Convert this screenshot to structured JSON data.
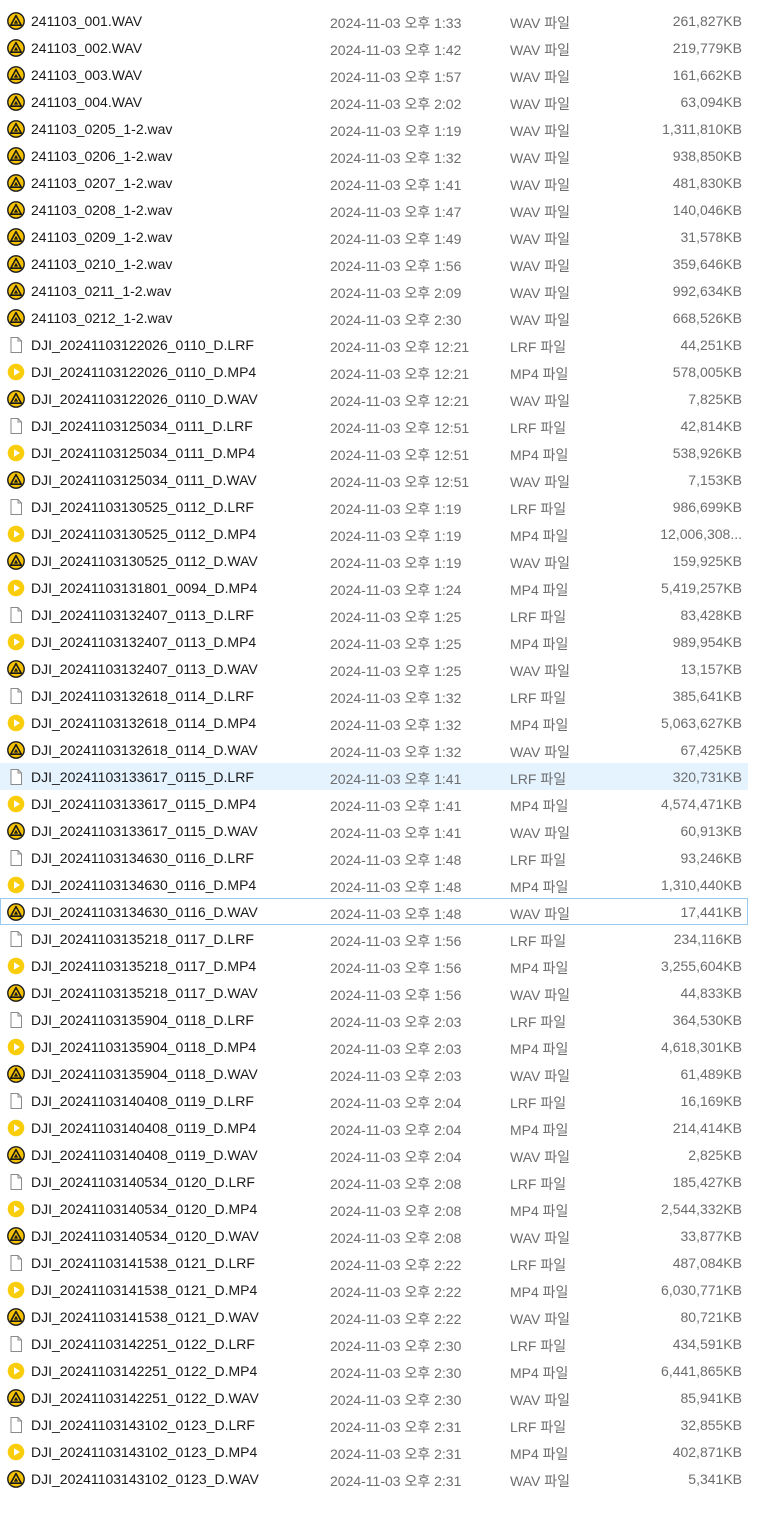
{
  "files": [
    {
      "name": "241103_001.WAV",
      "date": "2024-11-03 오후 1:33",
      "type": "WAV 파일",
      "size": "261,827KB",
      "icon": "audio-file-icon"
    },
    {
      "name": "241103_002.WAV",
      "date": "2024-11-03 오후 1:42",
      "type": "WAV 파일",
      "size": "219,779KB",
      "icon": "audio-file-icon"
    },
    {
      "name": "241103_003.WAV",
      "date": "2024-11-03 오후 1:57",
      "type": "WAV 파일",
      "size": "161,662KB",
      "icon": "audio-file-icon"
    },
    {
      "name": "241103_004.WAV",
      "date": "2024-11-03 오후 2:02",
      "type": "WAV 파일",
      "size": "63,094KB",
      "icon": "audio-file-icon"
    },
    {
      "name": "241103_0205_1-2.wav",
      "date": "2024-11-03 오후 1:19",
      "type": "WAV 파일",
      "size": "1,311,810KB",
      "icon": "audio-file-icon"
    },
    {
      "name": "241103_0206_1-2.wav",
      "date": "2024-11-03 오후 1:32",
      "type": "WAV 파일",
      "size": "938,850KB",
      "icon": "audio-file-icon"
    },
    {
      "name": "241103_0207_1-2.wav",
      "date": "2024-11-03 오후 1:41",
      "type": "WAV 파일",
      "size": "481,830KB",
      "icon": "audio-file-icon"
    },
    {
      "name": "241103_0208_1-2.wav",
      "date": "2024-11-03 오후 1:47",
      "type": "WAV 파일",
      "size": "140,046KB",
      "icon": "audio-file-icon"
    },
    {
      "name": "241103_0209_1-2.wav",
      "date": "2024-11-03 오후 1:49",
      "type": "WAV 파일",
      "size": "31,578KB",
      "icon": "audio-file-icon"
    },
    {
      "name": "241103_0210_1-2.wav",
      "date": "2024-11-03 오후 1:56",
      "type": "WAV 파일",
      "size": "359,646KB",
      "icon": "audio-file-icon"
    },
    {
      "name": "241103_0211_1-2.wav",
      "date": "2024-11-03 오후 2:09",
      "type": "WAV 파일",
      "size": "992,634KB",
      "icon": "audio-file-icon"
    },
    {
      "name": "241103_0212_1-2.wav",
      "date": "2024-11-03 오후 2:30",
      "type": "WAV 파일",
      "size": "668,526KB",
      "icon": "audio-file-icon"
    },
    {
      "name": "DJI_20241103122026_0110_D.LRF",
      "date": "2024-11-03 오후 12:21",
      "type": "LRF 파일",
      "size": "44,251KB",
      "icon": "blank-file-icon"
    },
    {
      "name": "DJI_20241103122026_0110_D.MP4",
      "date": "2024-11-03 오후 12:21",
      "type": "MP4 파일",
      "size": "578,005KB",
      "icon": "video-file-icon"
    },
    {
      "name": "DJI_20241103122026_0110_D.WAV",
      "date": "2024-11-03 오후 12:21",
      "type": "WAV 파일",
      "size": "7,825KB",
      "icon": "audio-file-icon"
    },
    {
      "name": "DJI_20241103125034_0111_D.LRF",
      "date": "2024-11-03 오후 12:51",
      "type": "LRF 파일",
      "size": "42,814KB",
      "icon": "blank-file-icon"
    },
    {
      "name": "DJI_20241103125034_0111_D.MP4",
      "date": "2024-11-03 오후 12:51",
      "type": "MP4 파일",
      "size": "538,926KB",
      "icon": "video-file-icon"
    },
    {
      "name": "DJI_20241103125034_0111_D.WAV",
      "date": "2024-11-03 오후 12:51",
      "type": "WAV 파일",
      "size": "7,153KB",
      "icon": "audio-file-icon"
    },
    {
      "name": "DJI_20241103130525_0112_D.LRF",
      "date": "2024-11-03 오후 1:19",
      "type": "LRF 파일",
      "size": "986,699KB",
      "icon": "blank-file-icon"
    },
    {
      "name": "DJI_20241103130525_0112_D.MP4",
      "date": "2024-11-03 오후 1:19",
      "type": "MP4 파일",
      "size": "12,006,308...",
      "icon": "video-file-icon"
    },
    {
      "name": "DJI_20241103130525_0112_D.WAV",
      "date": "2024-11-03 오후 1:19",
      "type": "WAV 파일",
      "size": "159,925KB",
      "icon": "audio-file-icon"
    },
    {
      "name": "DJI_20241103131801_0094_D.MP4",
      "date": "2024-11-03 오후 1:24",
      "type": "MP4 파일",
      "size": "5,419,257KB",
      "icon": "video-file-icon"
    },
    {
      "name": "DJI_20241103132407_0113_D.LRF",
      "date": "2024-11-03 오후 1:25",
      "type": "LRF 파일",
      "size": "83,428KB",
      "icon": "blank-file-icon"
    },
    {
      "name": "DJI_20241103132407_0113_D.MP4",
      "date": "2024-11-03 오후 1:25",
      "type": "MP4 파일",
      "size": "989,954KB",
      "icon": "video-file-icon"
    },
    {
      "name": "DJI_20241103132407_0113_D.WAV",
      "date": "2024-11-03 오후 1:25",
      "type": "WAV 파일",
      "size": "13,157KB",
      "icon": "audio-file-icon"
    },
    {
      "name": "DJI_20241103132618_0114_D.LRF",
      "date": "2024-11-03 오후 1:32",
      "type": "LRF 파일",
      "size": "385,641KB",
      "icon": "blank-file-icon"
    },
    {
      "name": "DJI_20241103132618_0114_D.MP4",
      "date": "2024-11-03 오후 1:32",
      "type": "MP4 파일",
      "size": "5,063,627KB",
      "icon": "video-file-icon"
    },
    {
      "name": "DJI_20241103132618_0114_D.WAV",
      "date": "2024-11-03 오후 1:32",
      "type": "WAV 파일",
      "size": "67,425KB",
      "icon": "audio-file-icon"
    },
    {
      "name": "DJI_20241103133617_0115_D.LRF",
      "date": "2024-11-03 오후 1:41",
      "type": "LRF 파일",
      "size": "320,731KB",
      "icon": "blank-file-icon",
      "highlighted": true
    },
    {
      "name": "DJI_20241103133617_0115_D.MP4",
      "date": "2024-11-03 오후 1:41",
      "type": "MP4 파일",
      "size": "4,574,471KB",
      "icon": "video-file-icon"
    },
    {
      "name": "DJI_20241103133617_0115_D.WAV",
      "date": "2024-11-03 오후 1:41",
      "type": "WAV 파일",
      "size": "60,913KB",
      "icon": "audio-file-icon"
    },
    {
      "name": "DJI_20241103134630_0116_D.LRF",
      "date": "2024-11-03 오후 1:48",
      "type": "LRF 파일",
      "size": "93,246KB",
      "icon": "blank-file-icon"
    },
    {
      "name": "DJI_20241103134630_0116_D.MP4",
      "date": "2024-11-03 오후 1:48",
      "type": "MP4 파일",
      "size": "1,310,440KB",
      "icon": "video-file-icon"
    },
    {
      "name": "DJI_20241103134630_0116_D.WAV",
      "date": "2024-11-03 오후 1:48",
      "type": "WAV 파일",
      "size": "17,441KB",
      "icon": "audio-file-icon",
      "focused": true
    },
    {
      "name": "DJI_20241103135218_0117_D.LRF",
      "date": "2024-11-03 오후 1:56",
      "type": "LRF 파일",
      "size": "234,116KB",
      "icon": "blank-file-icon"
    },
    {
      "name": "DJI_20241103135218_0117_D.MP4",
      "date": "2024-11-03 오후 1:56",
      "type": "MP4 파일",
      "size": "3,255,604KB",
      "icon": "video-file-icon"
    },
    {
      "name": "DJI_20241103135218_0117_D.WAV",
      "date": "2024-11-03 오후 1:56",
      "type": "WAV 파일",
      "size": "44,833KB",
      "icon": "audio-file-icon"
    },
    {
      "name": "DJI_20241103135904_0118_D.LRF",
      "date": "2024-11-03 오후 2:03",
      "type": "LRF 파일",
      "size": "364,530KB",
      "icon": "blank-file-icon"
    },
    {
      "name": "DJI_20241103135904_0118_D.MP4",
      "date": "2024-11-03 오후 2:03",
      "type": "MP4 파일",
      "size": "4,618,301KB",
      "icon": "video-file-icon"
    },
    {
      "name": "DJI_20241103135904_0118_D.WAV",
      "date": "2024-11-03 오후 2:03",
      "type": "WAV 파일",
      "size": "61,489KB",
      "icon": "audio-file-icon"
    },
    {
      "name": "DJI_20241103140408_0119_D.LRF",
      "date": "2024-11-03 오후 2:04",
      "type": "LRF 파일",
      "size": "16,169KB",
      "icon": "blank-file-icon"
    },
    {
      "name": "DJI_20241103140408_0119_D.MP4",
      "date": "2024-11-03 오후 2:04",
      "type": "MP4 파일",
      "size": "214,414KB",
      "icon": "video-file-icon"
    },
    {
      "name": "DJI_20241103140408_0119_D.WAV",
      "date": "2024-11-03 오후 2:04",
      "type": "WAV 파일",
      "size": "2,825KB",
      "icon": "audio-file-icon"
    },
    {
      "name": "DJI_20241103140534_0120_D.LRF",
      "date": "2024-11-03 오후 2:08",
      "type": "LRF 파일",
      "size": "185,427KB",
      "icon": "blank-file-icon"
    },
    {
      "name": "DJI_20241103140534_0120_D.MP4",
      "date": "2024-11-03 오후 2:08",
      "type": "MP4 파일",
      "size": "2,544,332KB",
      "icon": "video-file-icon"
    },
    {
      "name": "DJI_20241103140534_0120_D.WAV",
      "date": "2024-11-03 오후 2:08",
      "type": "WAV 파일",
      "size": "33,877KB",
      "icon": "audio-file-icon"
    },
    {
      "name": "DJI_20241103141538_0121_D.LRF",
      "date": "2024-11-03 오후 2:22",
      "type": "LRF 파일",
      "size": "487,084KB",
      "icon": "blank-file-icon"
    },
    {
      "name": "DJI_20241103141538_0121_D.MP4",
      "date": "2024-11-03 오후 2:22",
      "type": "MP4 파일",
      "size": "6,030,771KB",
      "icon": "video-file-icon"
    },
    {
      "name": "DJI_20241103141538_0121_D.WAV",
      "date": "2024-11-03 오후 2:22",
      "type": "WAV 파일",
      "size": "80,721KB",
      "icon": "audio-file-icon"
    },
    {
      "name": "DJI_20241103142251_0122_D.LRF",
      "date": "2024-11-03 오후 2:30",
      "type": "LRF 파일",
      "size": "434,591KB",
      "icon": "blank-file-icon"
    },
    {
      "name": "DJI_20241103142251_0122_D.MP4",
      "date": "2024-11-03 오후 2:30",
      "type": "MP4 파일",
      "size": "6,441,865KB",
      "icon": "video-file-icon"
    },
    {
      "name": "DJI_20241103142251_0122_D.WAV",
      "date": "2024-11-03 오후 2:30",
      "type": "WAV 파일",
      "size": "85,941KB",
      "icon": "audio-file-icon"
    },
    {
      "name": "DJI_20241103143102_0123_D.LRF",
      "date": "2024-11-03 오후 2:31",
      "type": "LRF 파일",
      "size": "32,855KB",
      "icon": "blank-file-icon"
    },
    {
      "name": "DJI_20241103143102_0123_D.MP4",
      "date": "2024-11-03 오후 2:31",
      "type": "MP4 파일",
      "size": "402,871KB",
      "icon": "video-file-icon"
    },
    {
      "name": "DJI_20241103143102_0123_D.WAV",
      "date": "2024-11-03 오후 2:31",
      "type": "WAV 파일",
      "size": "5,341KB",
      "icon": "audio-file-icon"
    }
  ],
  "colors": {
    "audio_icon_fill": "#f5c200",
    "audio_icon_ring": "#1a1a1a",
    "video_icon_fill": "#f9cd0a",
    "blank_icon_stroke": "#8a8a8a",
    "highlight_bg": "#e5f3ff",
    "focus_border": "#99c9ef",
    "secondary_text": "#6d6d6d"
  }
}
